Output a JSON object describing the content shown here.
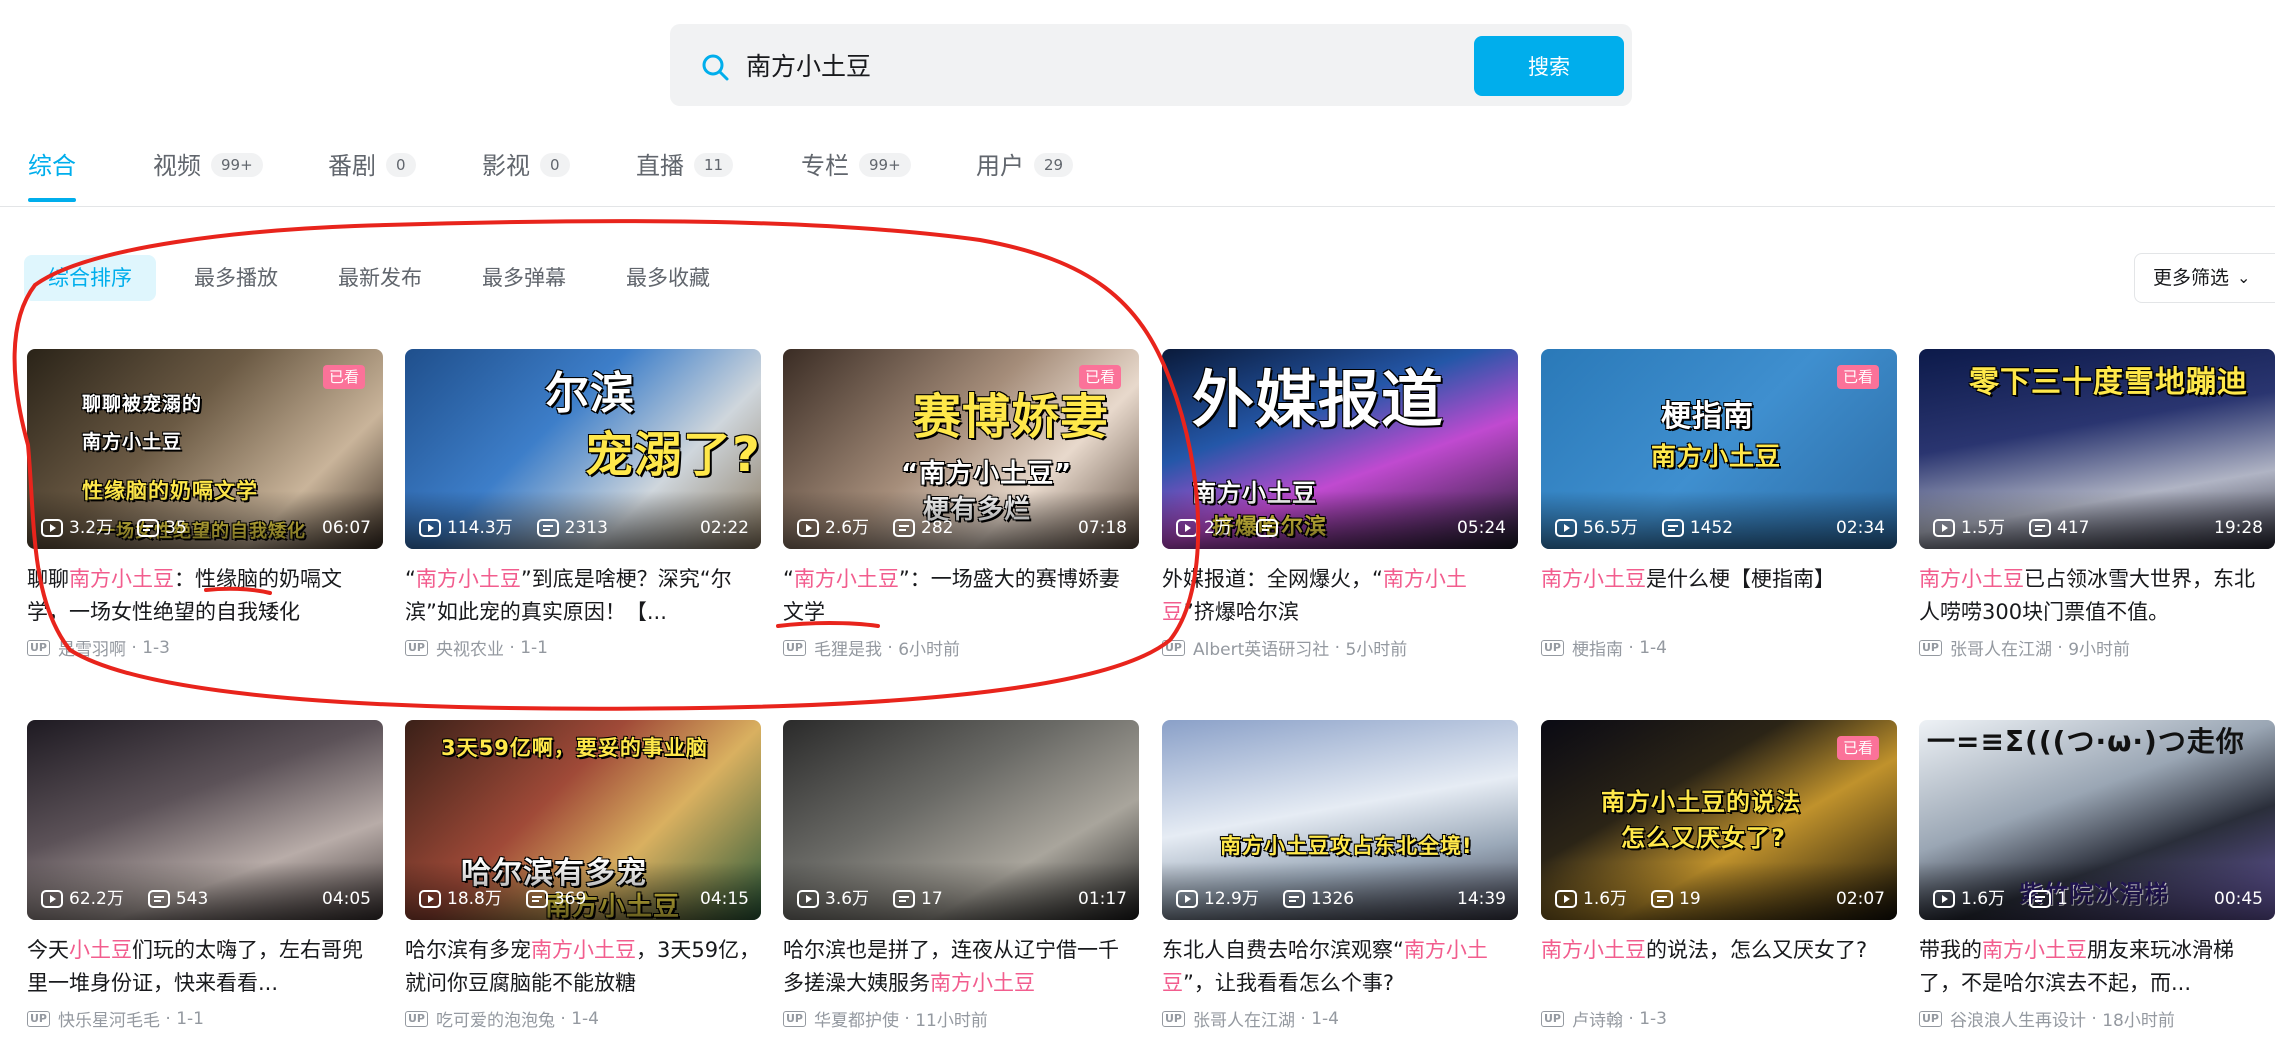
{
  "search": {
    "query": "南方小土豆",
    "button_label": "搜索"
  },
  "tabs": [
    {
      "label": "综合",
      "count": ""
    },
    {
      "label": "视频",
      "count": "99+"
    },
    {
      "label": "番剧",
      "count": "0"
    },
    {
      "label": "影视",
      "count": "0"
    },
    {
      "label": "直播",
      "count": "11"
    },
    {
      "label": "专栏",
      "count": "99+"
    },
    {
      "label": "用户",
      "count": "29"
    }
  ],
  "sort": [
    "综合排序",
    "最多播放",
    "最新发布",
    "最多弹幕",
    "最多收藏"
  ],
  "more_filter": "更多筛选",
  "watched_label": "已看",
  "videos": [
    {
      "plays": "3.2万",
      "danmaku": "35",
      "duration": "06:07",
      "title_pre": "聊聊",
      "title_hl": "南方小土豆",
      "title_post": "：性缘脑的奶嗝文学，一场女性绝望的自我矮化",
      "author": "是雪羽啊",
      "date": "1-3",
      "overlay1": "聊聊被宠溺的",
      "overlay2": "南方小土豆",
      "overlay3": "性缘脑的奶嗝文学",
      "overlay4": "一场女性绝望的自我矮化"
    },
    {
      "plays": "114.3万",
      "danmaku": "2313",
      "duration": "02:22",
      "title_pre": "“",
      "title_hl": "南方小土豆",
      "title_post": "”到底是啥梗？深究“尔滨”如此宠的真实原因！【...",
      "author": "央视农业",
      "date": "1-1",
      "overlay1": "尔滨",
      "overlay2": "宠溺了?"
    },
    {
      "plays": "2.6万",
      "danmaku": "282",
      "duration": "07:18",
      "title_pre": "“",
      "title_hl": "南方小土豆",
      "title_post": "”：一场盛大的赛博娇妻文学",
      "author": "毛狸是我",
      "date": "6小时前",
      "overlay1": "赛博娇妻",
      "overlay2": "“南方小土豆”",
      "overlay3": "梗有多烂"
    },
    {
      "plays": "2万",
      "danmaku": "",
      "duration": "05:24",
      "title_pre": "外媒报道：全网爆火，“",
      "title_hl": "南方小土豆",
      "title_post": "”挤爆哈尔滨",
      "author": "Albert英语研习社",
      "date": "5小时前",
      "overlay1": "外媒报道",
      "overlay2": "南方小土豆",
      "overlay3": "挤爆哈尔滨"
    },
    {
      "plays": "56.5万",
      "danmaku": "1452",
      "duration": "02:34",
      "title_pre": "",
      "title_hl": "南方小土豆",
      "title_post": "是什么梗【梗指南】",
      "author": "梗指南",
      "date": "1-4",
      "overlay1": "梗指南",
      "overlay2": "南方小土豆"
    },
    {
      "plays": "1.5万",
      "danmaku": "417",
      "duration": "19:28",
      "title_pre": "",
      "title_hl": "南方小土豆",
      "title_post": "已占领冰雪大世界，东北人唠唠300块门票值不值。",
      "author": "张哥人在江湖",
      "date": "9小时前",
      "overlay1": "零下三十度雪地蹦迪"
    },
    {
      "plays": "62.2万",
      "danmaku": "543",
      "duration": "04:05",
      "title_pre": "今天",
      "title_hl": "小土豆",
      "title_post": "们玩的太嗨了，左右哥兜里一堆身份证，快来看看...",
      "author": "快乐星河毛毛",
      "date": "1-1"
    },
    {
      "plays": "18.8万",
      "danmaku": "369",
      "duration": "04:15",
      "title_pre": "哈尔滨有多宠",
      "title_hl": "南方小土豆",
      "title_post": "，3天59亿，就问你豆腐脑能不能放糖",
      "author": "吃可爱的泡泡兔",
      "date": "1-4",
      "overlay1": "3天59亿啊，要妥的事业脑",
      "overlay2": "哈尔滨有多宠",
      "overlay3": "南方小土豆"
    },
    {
      "plays": "3.6万",
      "danmaku": "17",
      "duration": "01:17",
      "title_pre": "哈尔滨也是拼了，连夜从辽宁借一千多搓澡大姨服务",
      "title_hl": "南方小土豆",
      "title_post": "",
      "author": "华夏都护使",
      "date": "11小时前"
    },
    {
      "plays": "12.9万",
      "danmaku": "1326",
      "duration": "14:39",
      "title_pre": "东北人自费去哈尔滨观察“",
      "title_hl": "南方小土豆",
      "title_post": "”，让我看看怎么个事?",
      "author": "张哥人在江湖",
      "date": "1-4",
      "overlay1": "南方小土豆攻占东北全境!"
    },
    {
      "plays": "1.6万",
      "danmaku": "19",
      "duration": "02:07",
      "title_pre": "",
      "title_hl": "南方小土豆",
      "title_post": "的说法，怎么又厌女了?",
      "author": "卢诗翰",
      "date": "1-3",
      "overlay1": "南方小土豆的说法",
      "overlay2": "怎么又厌女了?"
    },
    {
      "plays": "1.6万",
      "danmaku": "1",
      "duration": "00:45",
      "title_pre": "带我的",
      "title_hl": "南方小土豆",
      "title_post": "朋友来玩冰滑梯了，不是哈尔滨去不起，而...",
      "author": "谷浪浪人生再设计",
      "date": "18小时前",
      "overlay1": "一=≡Σ(((つ·ω·)つ走你",
      "overlay2": "紫竹院冰滑梯"
    }
  ],
  "colors": {
    "accent": "#00aeec",
    "highlight": "#f25d8e",
    "badge": "#fb7299",
    "annotation": "#e8241c"
  }
}
